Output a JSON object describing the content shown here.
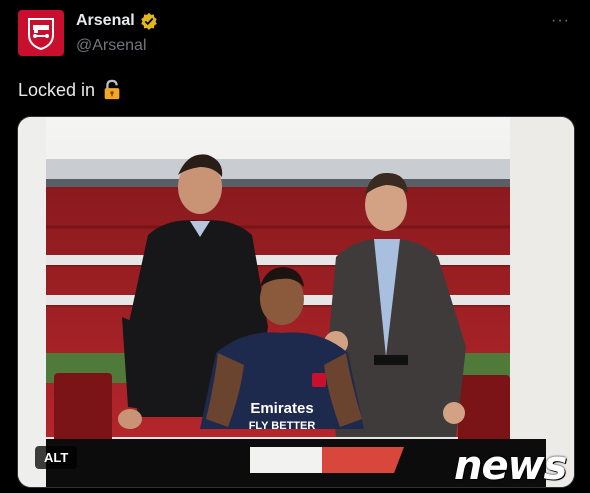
{
  "tweet": {
    "display_name": "Arsenal",
    "handle": "@Arsenal",
    "text": "Locked in",
    "more_label": "···"
  },
  "media": {
    "alt_label": "ALT",
    "shirt_sponsor": "Emirates",
    "shirt_tagline": "FLY BETTER",
    "watermark": "news"
  },
  "icons": {
    "avatar": "arsenal-crest-icon",
    "verified": "verified-badge-icon",
    "lock": "locked-emoji-icon",
    "more": "more-options-icon"
  },
  "colors": {
    "brand_red": "#c8102e",
    "verified_gold": "#e2b719",
    "text_primary": "#e7e9ea",
    "text_secondary": "#71767b"
  }
}
